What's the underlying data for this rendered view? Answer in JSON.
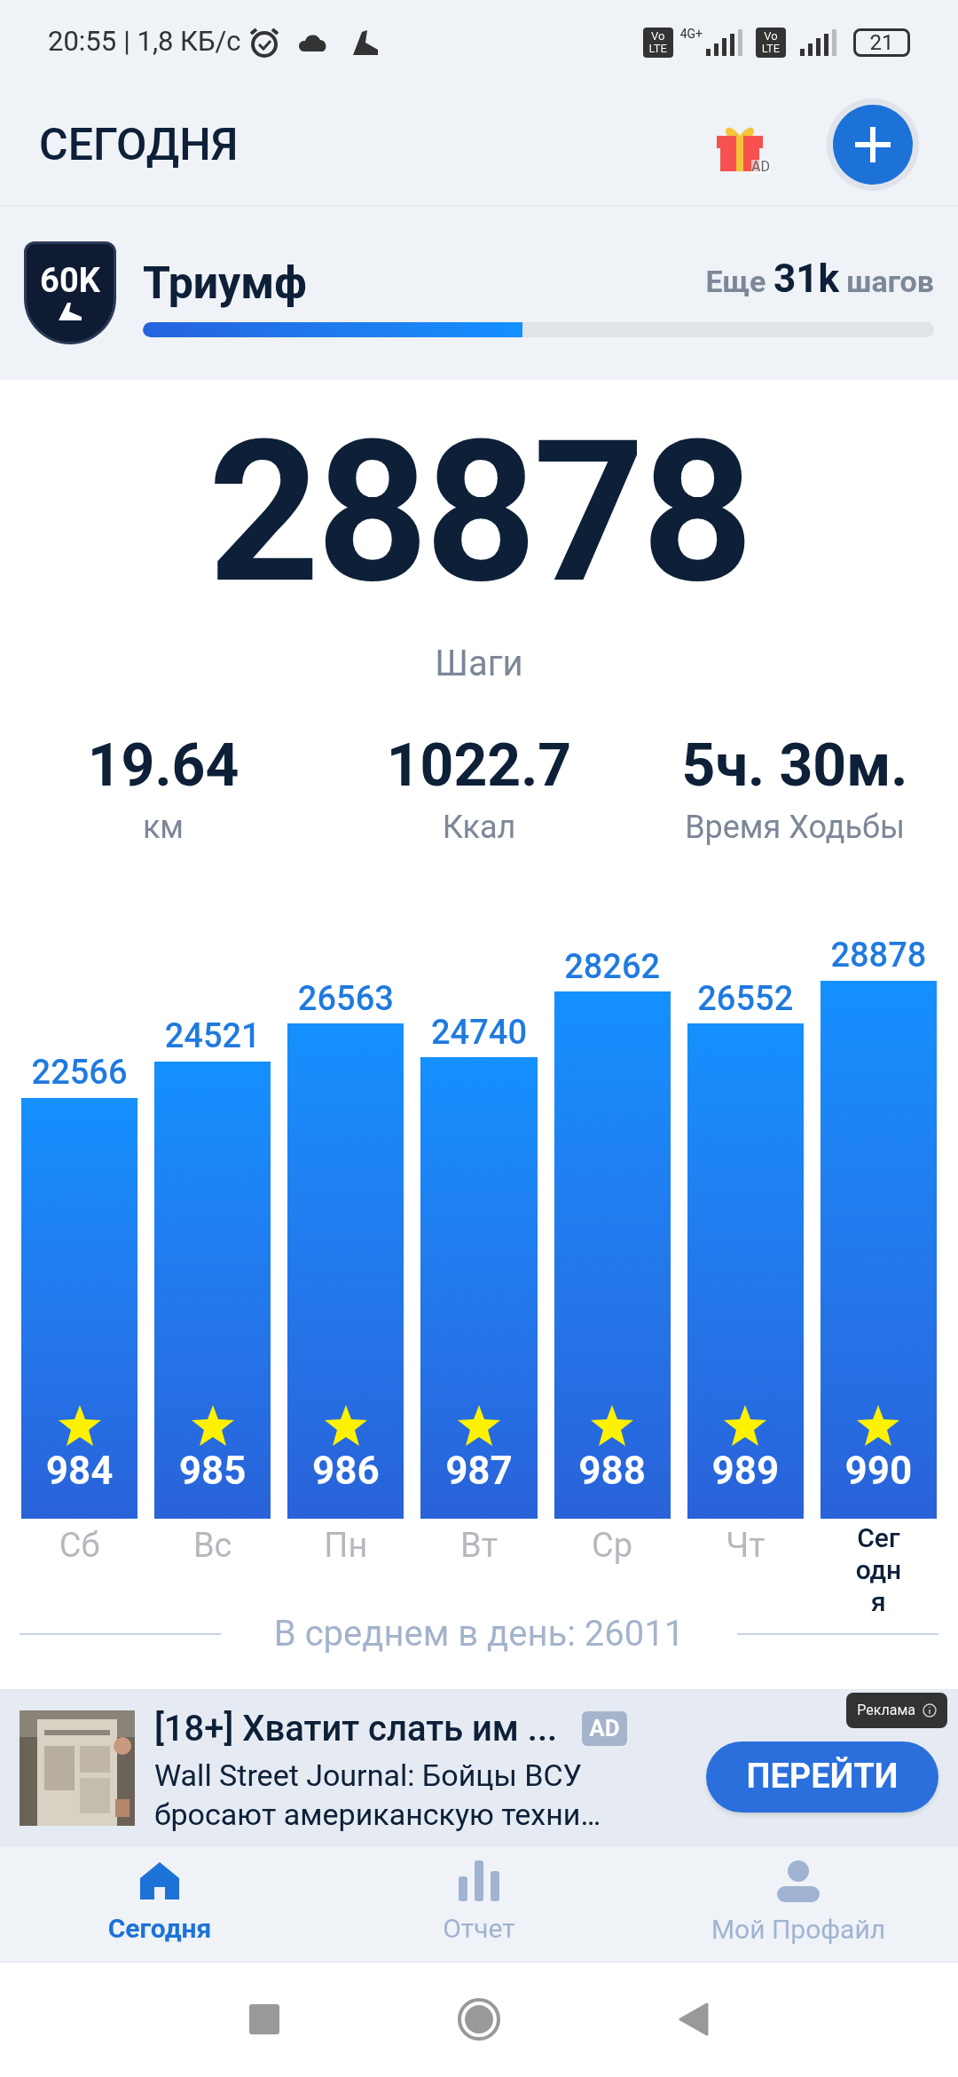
{
  "status_bar": {
    "time": "20:55",
    "speed": "| 1,8 КБ/с",
    "network_label": "4G+",
    "battery": "21",
    "volte": [
      "Vo LTE",
      "Vo LTE"
    ]
  },
  "header": {
    "title": "СЕГОДНЯ",
    "gift_badge": "AD"
  },
  "achievement": {
    "badge": "60K",
    "name": "Триумф",
    "remaining_prefix": "Еще",
    "remaining_value": "31k",
    "remaining_suffix": "шагов",
    "level": 0.48
  },
  "steps": {
    "value": "28878",
    "label": "Шаги"
  },
  "stats": [
    {
      "value": "19.64",
      "label": "км"
    },
    {
      "value": "1022.7",
      "label": "Ккал"
    },
    {
      "value": "5ч. 30м.",
      "label": "Время Ходьбы"
    }
  ],
  "chart_data": {
    "type": "bar",
    "categories": [
      "Сб",
      "Вс",
      "Пн",
      "Вт",
      "Ср",
      "Чт",
      "Сегодня"
    ],
    "values": [
      22566,
      24521,
      26563,
      24740,
      28262,
      26552,
      28878
    ],
    "data_labels": true,
    "annotations": [
      "984",
      "985",
      "986",
      "987",
      "988",
      "989",
      "990"
    ]
  },
  "days_selected": [
    false,
    false,
    false,
    false,
    false,
    false,
    true
  ],
  "average": "В среднем в день: 26011",
  "ad": {
    "kind": "picture",
    "title": "[18+] Хватит слать им ...",
    "tag": "AD",
    "text": "Wall Street Journal: Бойцы ВСУ бросают американскую техни…",
    "button": "ПЕРЕЙТИ",
    "label": "Реклама"
  },
  "nav": [
    {
      "label": "Сегодня",
      "selected": true
    },
    {
      "label": "Отчет",
      "selected": false
    },
    {
      "label": "Мой Профайл",
      "selected": false
    }
  ]
}
